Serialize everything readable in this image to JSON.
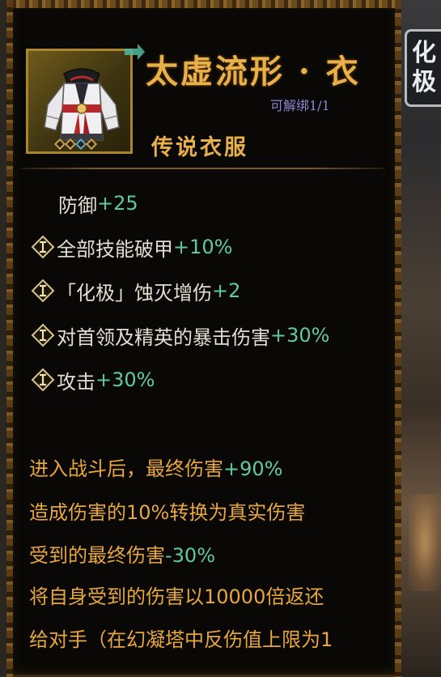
{
  "item": {
    "name": "太虚流形 · 衣",
    "bind_status": "可解绑1/1",
    "type": "传说衣服",
    "icon": "robe-armor-icon"
  },
  "side_badge": {
    "chars": [
      "化",
      "极"
    ]
  },
  "stats": [
    {
      "label": "防御",
      "value": "+25",
      "rune": false
    },
    {
      "label": "全部技能破甲",
      "value": "+10%",
      "rune": true
    },
    {
      "label": "「化极」蚀灭增伤",
      "value": "+2",
      "rune": true
    },
    {
      "label": "对首领及精英的暴击伤害",
      "value": "+30%",
      "rune": true
    },
    {
      "label": "攻击",
      "value": "+30%",
      "rune": true
    }
  ],
  "effects": [
    {
      "text": "进入战斗后，最终伤害",
      "value": "+90%"
    },
    {
      "text": "造成伤害的10%转换为真实伤害",
      "value": ""
    },
    {
      "text": "受到的最终伤害",
      "value": "-30%"
    },
    {
      "text": "将自身受到的伤害以10000倍返还",
      "value": ""
    },
    {
      "text": "给对手（在幻凝塔中反伤值上限为1",
      "value": ""
    }
  ],
  "colors": {
    "title_gold": "#e8b04a",
    "stat_value_green": "#5fc8a4",
    "effect_orange": "#e7a73c",
    "bind_purple": "#8f86d6"
  }
}
